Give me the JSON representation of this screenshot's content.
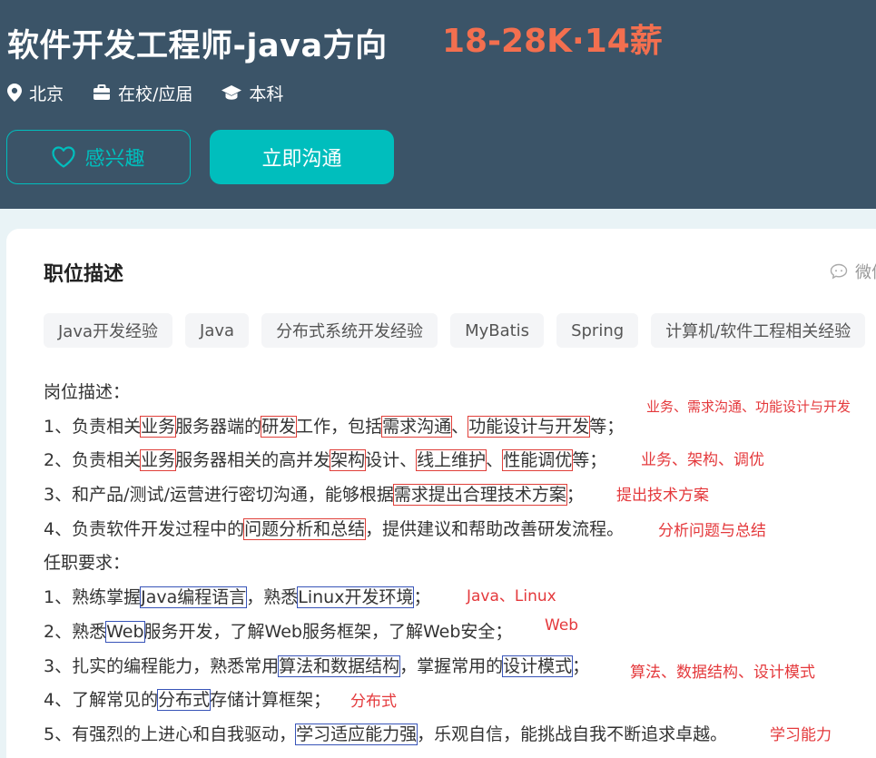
{
  "header": {
    "job_title": "软件开发工程师-java方向",
    "salary": "18-28K·14薪",
    "location": "北京",
    "experience": "在校/应届",
    "degree": "本科",
    "like_label": "感兴趣",
    "chat_label": "立即沟通"
  },
  "card": {
    "section_title": "职位描述",
    "wechat_label": "微信",
    "tags": [
      "Java开发经验",
      "Java",
      "分布式系统开发经验",
      "MyBatis",
      "Spring",
      "计算机/软件工程相关经验"
    ]
  },
  "desc": {
    "duties_title": "岗位描述：",
    "l1": {
      "a": "1、负责相关",
      "b": "业务",
      "c": "服务器端的",
      "d": "研发",
      "e": "工作，包括",
      "f": "需求沟通",
      "g": "、",
      "h": "功能设计与开发",
      "i": "等；"
    },
    "l2": {
      "a": "2、负责相关",
      "b": "业务",
      "c": "服务器相关的高并发",
      "d": "架构",
      "e": "设计、",
      "f": "线上维护",
      "g": "、",
      "h": "性能调优",
      "i": "等；"
    },
    "l3": {
      "a": "3、和产品/测试/运营进行密切沟通，能够根据",
      "b": "需求提出合理技术方案",
      "c": "；"
    },
    "l4": {
      "a": "4、负责软件开发过程中的",
      "b": "问题分析和总结",
      "c": "，提供建议和帮助改善研发流程。"
    },
    "req_title": "任职要求：",
    "r1": {
      "a": "1、熟练掌握",
      "b": "Java编程语言",
      "c": "，熟悉",
      "d": "Linux开发环境",
      "e": "；"
    },
    "r2": {
      "a": "2、熟悉",
      "b": "Web",
      "c": "服务开发，了解Web服务框架，了解Web安全；"
    },
    "r3": {
      "a": "3、扎实的编程能力，熟悉常用",
      "b": "算法和数据结构",
      "c": "，掌握常用的",
      "d": "设计模式",
      "e": "；"
    },
    "r4": {
      "a": "4、了解常见的",
      "b": "分布式",
      "c": "存储计算框架；"
    },
    "r5": {
      "a": "5、有强烈的上进心和自我驱动，",
      "b": "学习适应能力强",
      "c": "，乐观自信，能挑战自我不断追求卓越。"
    }
  },
  "notes": {
    "n1": "业务、需求沟通、功能设计与开发",
    "n2": "业务、架构、调优",
    "n3": "提出技术方案",
    "n4": "分析问题与总结",
    "n5": "Java、Linux",
    "n6": "Web",
    "n7": "算法、数据结构、设计模式",
    "n8": "分布式",
    "n9": "学习能力"
  },
  "colors": {
    "header_bg": "#3b5468",
    "salary": "#f36f4f",
    "accent": "#00bebd",
    "note_red": "#e4393c",
    "box_red": "#e0403a",
    "box_blue": "#3854b8"
  },
  "icons": {
    "location": "location-pin-icon",
    "experience": "briefcase-icon",
    "degree": "graduation-cap-icon",
    "like": "heart-icon",
    "wechat": "chat-bubble-icon"
  }
}
